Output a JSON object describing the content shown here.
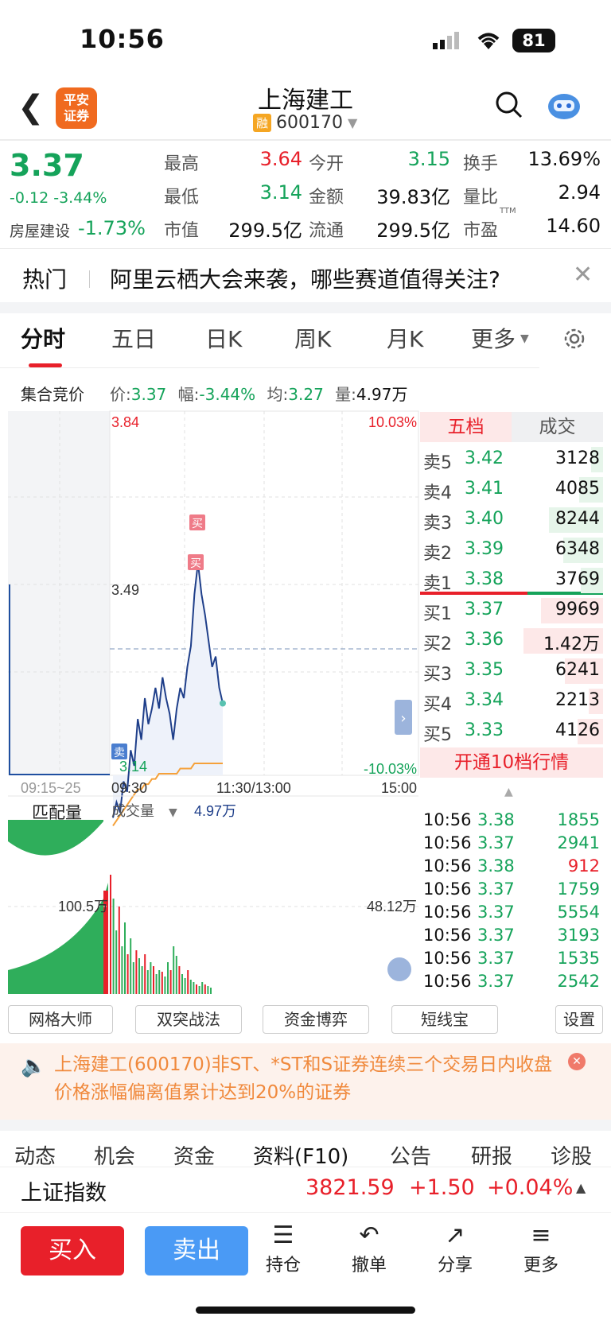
{
  "status_bar": {
    "time": "10:56",
    "battery": "81"
  },
  "header": {
    "title": "上海建工",
    "margin_tag": "融",
    "code": "600170",
    "logo_text": "平安\n证券"
  },
  "quote": {
    "price": "3.37",
    "change": "-0.12",
    "change_pct": "-3.44%",
    "sector_label": "房屋建设",
    "sector_pct": "-1.73%",
    "stats": [
      {
        "label": "最高",
        "value": "3.64",
        "color": "red"
      },
      {
        "label": "今开",
        "value": "3.15",
        "color": "green"
      },
      {
        "label": "换手",
        "value": "13.69%",
        "color": "black"
      },
      {
        "label": "最低",
        "value": "3.14",
        "color": "green"
      },
      {
        "label": "金额",
        "value": "39.83亿",
        "color": "black"
      },
      {
        "label": "量比",
        "value": "2.94",
        "color": "black"
      },
      {
        "label": "市值",
        "value": "299.5亿",
        "color": "black"
      },
      {
        "label": "流通",
        "value": "299.5亿",
        "color": "black"
      },
      {
        "label": "市盈",
        "value": "14.60",
        "color": "black",
        "sup": "TTM"
      }
    ]
  },
  "hot": {
    "tag": "热门",
    "text": "阿里云栖大会来袭，哪些赛道值得关注?"
  },
  "tabs": [
    "分时",
    "五日",
    "日K",
    "周K",
    "月K",
    "更多"
  ],
  "chart_info": {
    "auction": "集合竞价",
    "price_lbl": "价:",
    "price": "3.37",
    "amp_lbl": "幅:",
    "amp": "-3.44%",
    "avg_lbl": "均:",
    "avg": "3.27",
    "vol_lbl": "量:",
    "vol": "4.97万"
  },
  "chart_data": {
    "type": "line",
    "title": "",
    "ylim": [
      3.14,
      3.84
    ],
    "ref_price": 3.49,
    "y_labels": {
      "top": "3.84",
      "mid": "3.49",
      "bottom": "3.14",
      "top_pct": "10.03%",
      "bottom_pct": "-10.03%"
    },
    "x_labels": [
      "09:15~25",
      "09:30",
      "11:30/13:00",
      "15:00"
    ],
    "series": [
      {
        "values": [
          3.15,
          3.18,
          3.16,
          3.22,
          3.2,
          3.28,
          3.25,
          3.34,
          3.3,
          3.38,
          3.33,
          3.36,
          3.4,
          3.36,
          3.42,
          3.38,
          3.35,
          3.3,
          3.36,
          3.4,
          3.38,
          3.44,
          3.48,
          3.58,
          3.64,
          3.58,
          3.54,
          3.49,
          3.44,
          3.46,
          3.4,
          3.37
        ]
      },
      {
        "values": [
          3.15,
          3.16,
          3.17,
          3.18,
          3.19,
          3.2,
          3.21,
          3.22,
          3.22,
          3.23,
          3.23,
          3.24,
          3.24,
          3.25,
          3.25,
          3.25,
          3.25,
          3.25,
          3.25,
          3.26,
          3.26,
          3.26,
          3.26,
          3.27,
          3.27,
          3.27,
          3.27,
          3.27,
          3.27,
          3.27,
          3.27,
          3.27
        ]
      }
    ],
    "markers": [
      "买",
      "买",
      "卖"
    ],
    "volume": {
      "label": "成交量",
      "value": "4.97万",
      "left_label": "匹配量",
      "left_value": "100.5万",
      "right_value": "48.12万"
    }
  },
  "orderbook": {
    "tabs": [
      "五档",
      "成交"
    ],
    "asks": [
      {
        "label": "卖5",
        "price": "3.42",
        "vol": "3128",
        "bar": 0.15
      },
      {
        "label": "卖4",
        "price": "3.41",
        "vol": "4085",
        "bar": 0.3
      },
      {
        "label": "卖3",
        "price": "3.40",
        "vol": "8244",
        "bar": 0.68
      },
      {
        "label": "卖2",
        "price": "3.39",
        "vol": "6348",
        "bar": 0.5
      },
      {
        "label": "卖1",
        "price": "3.38",
        "vol": "3769",
        "bar": 0.28
      }
    ],
    "bids": [
      {
        "label": "买1",
        "price": "3.37",
        "vol": "9969",
        "bar": 0.78
      },
      {
        "label": "买2",
        "price": "3.36",
        "vol": "1.42万",
        "bar": 1.0
      },
      {
        "label": "买3",
        "price": "3.35",
        "vol": "6241",
        "bar": 0.48
      },
      {
        "label": "买4",
        "price": "3.34",
        "vol": "2213",
        "bar": 0.18
      },
      {
        "label": "买5",
        "price": "3.33",
        "vol": "4126",
        "bar": 0.32
      }
    ],
    "upgrade": "开通10档行情"
  },
  "ticks": [
    {
      "time": "10:56",
      "price": "3.38",
      "vol": "1855",
      "color": "green"
    },
    {
      "time": "10:56",
      "price": "3.37",
      "vol": "2941",
      "color": "green"
    },
    {
      "time": "10:56",
      "price": "3.38",
      "vol": "912",
      "color": "red"
    },
    {
      "time": "10:56",
      "price": "3.37",
      "vol": "1759",
      "color": "green"
    },
    {
      "time": "10:56",
      "price": "3.37",
      "vol": "5554",
      "color": "green"
    },
    {
      "time": "10:56",
      "price": "3.37",
      "vol": "3193",
      "color": "green"
    },
    {
      "time": "10:56",
      "price": "3.37",
      "vol": "1535",
      "color": "green"
    },
    {
      "time": "10:56",
      "price": "3.37",
      "vol": "2542",
      "color": "green"
    }
  ],
  "tools": [
    "网格大师",
    "双突战法",
    "资金博弈",
    "短线宝",
    "设置"
  ],
  "notice": "上海建工(600170)非ST、*ST和S证券连续三个交易日内收盘价格涨幅偏离值累计达到20%的证券",
  "bottom_tabs": [
    "动态",
    "机会",
    "资金",
    "资料(F10)",
    "公告",
    "研报",
    "诊股"
  ],
  "index": {
    "name": "上证指数",
    "value": "3821.59",
    "change": "+1.50",
    "pct": "+0.04%"
  },
  "actions": {
    "buy": "买入",
    "sell": "卖出",
    "nav": [
      {
        "label": "持仓",
        "icon": "list-icon"
      },
      {
        "label": "撤单",
        "icon": "undo-icon"
      },
      {
        "label": "分享",
        "icon": "share-icon"
      },
      {
        "label": "更多",
        "icon": "menu-icon"
      }
    ]
  }
}
